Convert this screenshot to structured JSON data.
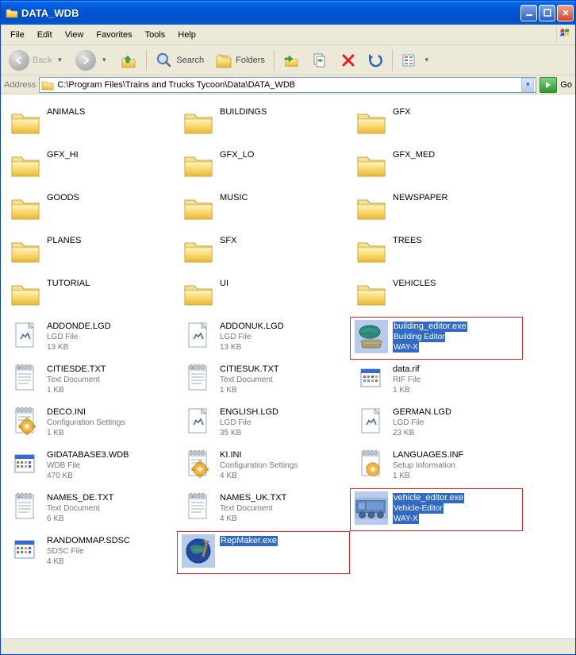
{
  "window": {
    "title": "DATA_WDB"
  },
  "menu": {
    "file": "File",
    "edit": "Edit",
    "view": "View",
    "favorites": "Favorites",
    "tools": "Tools",
    "help": "Help"
  },
  "toolbar": {
    "back": "Back",
    "search": "Search",
    "folders": "Folders"
  },
  "address": {
    "label": "Address",
    "value": "C:\\Program Files\\Trains and Trucks Tycoon\\Data\\DATA_WDB",
    "go": "Go"
  },
  "items": [
    {
      "kind": "folder",
      "name": "ANIMALS"
    },
    {
      "kind": "folder",
      "name": "BUILDINGS"
    },
    {
      "kind": "folder",
      "name": "GFX"
    },
    {
      "kind": "folder",
      "name": "GFX_HI"
    },
    {
      "kind": "folder",
      "name": "GFX_LO"
    },
    {
      "kind": "folder",
      "name": "GFX_MED"
    },
    {
      "kind": "folder",
      "name": "GOODS"
    },
    {
      "kind": "folder",
      "name": "MUSIC"
    },
    {
      "kind": "folder",
      "name": "NEWSPAPER"
    },
    {
      "kind": "folder",
      "name": "PLANES"
    },
    {
      "kind": "folder",
      "name": "SFX"
    },
    {
      "kind": "folder",
      "name": "TREES"
    },
    {
      "kind": "folder",
      "name": "TUTORIAL"
    },
    {
      "kind": "folder",
      "name": "UI"
    },
    {
      "kind": "folder",
      "name": "VEHICLES"
    },
    {
      "kind": "lgd",
      "name": "ADDONDE.LGD",
      "type": "LGD File",
      "size": "13 KB"
    },
    {
      "kind": "lgd",
      "name": "ADDONUK.LGD",
      "type": "LGD File",
      "size": "13 KB"
    },
    {
      "kind": "exe-build",
      "name": "building_editor.exe",
      "type": "Building Editor",
      "size": "WAY-X",
      "selected": true,
      "highlighted": true
    },
    {
      "kind": "txt",
      "name": "CITIESDE.TXT",
      "type": "Text Document",
      "size": "1 KB"
    },
    {
      "kind": "txt",
      "name": "CITIESUK.TXT",
      "type": "Text Document",
      "size": "1 KB"
    },
    {
      "kind": "rif",
      "name": "data.rif",
      "type": "RIF File",
      "size": "1 KB"
    },
    {
      "kind": "ini",
      "name": "DECO.INI",
      "type": "Configuration Settings",
      "size": "1 KB"
    },
    {
      "kind": "lgd",
      "name": "ENGLISH.LGD",
      "type": "LGD File",
      "size": "35 KB"
    },
    {
      "kind": "lgd",
      "name": "GERMAN.LGD",
      "type": "LGD File",
      "size": "23 KB"
    },
    {
      "kind": "wdb",
      "name": "GIDATABASE3.WDB",
      "type": "WDB File",
      "size": "470 KB"
    },
    {
      "kind": "ini",
      "name": "KI.INI",
      "type": "Configuration Settings",
      "size": "4 KB"
    },
    {
      "kind": "inf",
      "name": "LANGUAGES.INF",
      "type": "Setup Information",
      "size": "1 KB"
    },
    {
      "kind": "txt",
      "name": "NAMES_DE.TXT",
      "type": "Text Document",
      "size": "6 KB"
    },
    {
      "kind": "txt",
      "name": "NAMES_UK.TXT",
      "type": "Text Document",
      "size": "4 KB"
    },
    {
      "kind": "exe-vehicle",
      "name": "vehicle_editor.exe",
      "type": "Vehicle-Editor",
      "size": "WAY-X",
      "selected": true,
      "highlighted": true
    },
    {
      "kind": "sdsc",
      "name": "RANDOMMAP.SDSC",
      "type": "SDSC File",
      "size": "4 KB"
    },
    {
      "kind": "exe-rep",
      "name": "RepMaker.exe",
      "selected": true,
      "highlighted": true
    }
  ]
}
